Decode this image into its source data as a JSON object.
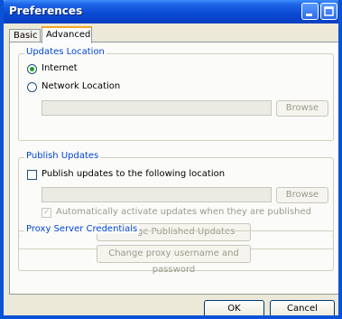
{
  "window": {
    "title": "Preferences"
  },
  "tabs": [
    {
      "label": "Basic"
    },
    {
      "label": "Advanced"
    }
  ],
  "updates_location": {
    "legend": "Updates Location",
    "options": [
      {
        "label": "Internet",
        "selected": true
      },
      {
        "label": "Network Location",
        "selected": false
      }
    ],
    "path_value": "",
    "browse_label": "Browse"
  },
  "publish_updates": {
    "legend": "Publish Updates",
    "checkbox_label": "Publish updates to the following location",
    "checked": false,
    "path_value": "",
    "browse_label": "Browse",
    "auto_activate_label": "Automatically activate updates when they are published",
    "auto_activate_checked": true,
    "manage_button_label": "Manage Published Updates"
  },
  "proxy": {
    "legend": "Proxy Server Credentials",
    "change_button_label": "Change proxy username and password"
  },
  "footer": {
    "ok_label": "OK",
    "cancel_label": "Cancel"
  },
  "colors": {
    "titlebar": "#0a49d3",
    "legend_text": "#0046d5",
    "active_tab_accent": "#f7a824",
    "radio_dot": "#21a121"
  }
}
